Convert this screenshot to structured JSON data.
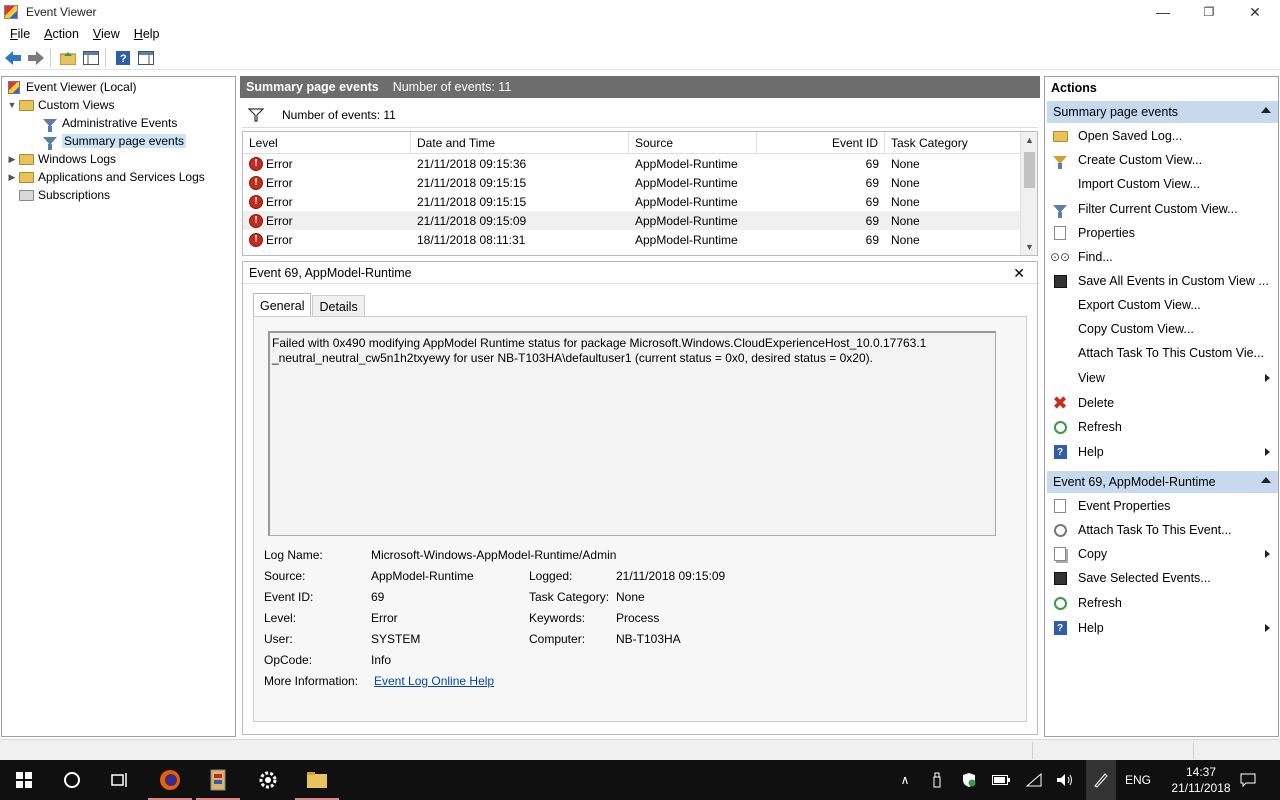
{
  "window": {
    "title": "Event Viewer",
    "minimize_glyph": "—",
    "maximize_glyph": "❐",
    "close_glyph": "✕"
  },
  "menu": [
    {
      "label": "File",
      "hotkey": "F"
    },
    {
      "label": "Action",
      "hotkey": "A"
    },
    {
      "label": "View",
      "hotkey": "V"
    },
    {
      "label": "Help",
      "hotkey": "H"
    }
  ],
  "menu_labels": {
    "file": "ile",
    "action": "ction",
    "view": "iew",
    "help": "elp"
  },
  "menu_hotkeys": {
    "file": "F",
    "action": "A",
    "view": "V",
    "help": "H"
  },
  "tree": {
    "root": "Event Viewer (Local)",
    "custom_views": "Custom Views",
    "administrative_events": "Administrative Events",
    "summary_page_events": "Summary page events",
    "windows_logs": "Windows Logs",
    "app_services_logs": "Applications and Services Logs",
    "subscriptions": "Subscriptions"
  },
  "summary": {
    "title": "Summary page events",
    "count_label": "Number of events: 11",
    "filter_label": "Number of events: 11"
  },
  "grid": {
    "headers": {
      "level": "Level",
      "datetime": "Date and Time",
      "source": "Source",
      "eventid": "Event ID",
      "category": "Task Category"
    },
    "rows": [
      {
        "level": "Error",
        "datetime": "21/11/2018 09:15:36",
        "source": "AppModel-Runtime",
        "eventid": "69",
        "category": "None"
      },
      {
        "level": "Error",
        "datetime": "21/11/2018 09:15:15",
        "source": "AppModel-Runtime",
        "eventid": "69",
        "category": "None"
      },
      {
        "level": "Error",
        "datetime": "21/11/2018 09:15:15",
        "source": "AppModel-Runtime",
        "eventid": "69",
        "category": "None"
      },
      {
        "level": "Error",
        "datetime": "21/11/2018 09:15:09",
        "source": "AppModel-Runtime",
        "eventid": "69",
        "category": "None"
      },
      {
        "level": "Error",
        "datetime": "18/11/2018 08:11:31",
        "source": "AppModel-Runtime",
        "eventid": "69",
        "category": "None"
      }
    ]
  },
  "detail": {
    "title": "Event 69, AppModel-Runtime",
    "tab_general": "General",
    "tab_details": "Details",
    "message_line1": "Failed with 0x490 modifying AppModel Runtime status for package Microsoft.Windows.CloudExperienceHost_10.0.17763.1",
    "message_line2": "_neutral_neutral_cw5n1h2txyewy for user NB-T103HA\\defaultuser1 (current status = 0x0, desired status = 0x20).",
    "labels": {
      "log_name": "Log Name:",
      "source": "Source:",
      "event_id": "Event ID:",
      "level": "Level:",
      "user": "User:",
      "opcode": "OpCode:",
      "more_info": "More Information:",
      "logged": "Logged:",
      "task_category": "Task Category:",
      "keywords": "Keywords:",
      "computer": "Computer:"
    },
    "values": {
      "log_name": "Microsoft-Windows-AppModel-Runtime/Admin",
      "source": "AppModel-Runtime",
      "event_id": "69",
      "level": "Error",
      "user": "SYSTEM",
      "opcode": "Info",
      "more_info_link": "Event Log Online Help",
      "logged": "21/11/2018 09:15:09",
      "task_category": "None",
      "keywords": "Process",
      "computer": "NB-T103HA"
    }
  },
  "actions": {
    "title": "Actions",
    "section1": "Summary page events",
    "s1": {
      "open_saved": "Open Saved Log...",
      "create_custom": "Create Custom View...",
      "import_custom": "Import Custom View...",
      "filter_current": "Filter Current Custom View...",
      "properties": "Properties",
      "find": "Find...",
      "save_all": "Save All Events in Custom View ...",
      "export_custom": "Export Custom View...",
      "copy_custom": "Copy Custom View...",
      "attach_task_custom": "Attach Task To This Custom Vie...",
      "view": "View",
      "delete": "Delete",
      "refresh": "Refresh",
      "help": "Help"
    },
    "section2": "Event 69, AppModel-Runtime",
    "s2": {
      "event_properties": "Event Properties",
      "attach_task_event": "Attach Task To This Event...",
      "copy": "Copy",
      "save_selected": "Save Selected Events...",
      "refresh": "Refresh",
      "help": "Help"
    }
  },
  "taskbar": {
    "lang": "ENG",
    "time": "14:37",
    "date": "21/11/2018"
  },
  "colors": {
    "summary_header_bg": "#6d6d6d",
    "action_section_bg": "#c6d9ef",
    "error_red": "#c42b1c",
    "link": "#0645ad",
    "taskbar_bg": "#101010"
  }
}
